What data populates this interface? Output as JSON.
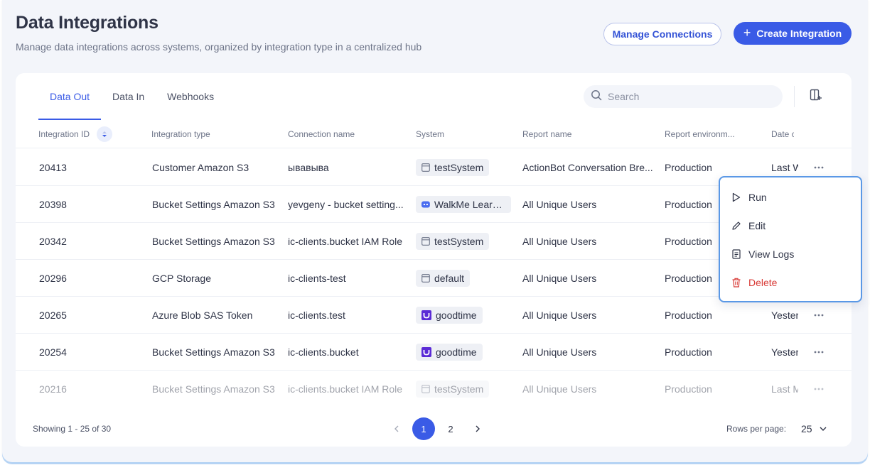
{
  "header": {
    "title": "Data Integrations",
    "subtitle": "Manage data integrations across systems, organized by integration type in a centralized hub",
    "manage_label": "Manage Connections",
    "create_label": "Create Integration"
  },
  "tabs": [
    {
      "label": "Data Out",
      "active": true
    },
    {
      "label": "Data In",
      "active": false
    },
    {
      "label": "Webhooks",
      "active": false
    }
  ],
  "search": {
    "placeholder": "Search"
  },
  "columns": {
    "id": "Integration ID",
    "type": "Integration type",
    "connection": "Connection name",
    "system": "System",
    "report": "Report name",
    "env": "Report environm...",
    "date": "Date c"
  },
  "rows": [
    {
      "id": "20413",
      "type": "Customer Amazon S3",
      "connection": "ывавыва",
      "system": "testSystem",
      "system_icon": "window-icon",
      "report": "ActionBot Conversation Bre...",
      "env": "Production",
      "date": "Last W"
    },
    {
      "id": "20398",
      "type": "Bucket Settings Amazon S3",
      "connection": "yevgeny - bucket setting...",
      "system": "WalkMe Learn...",
      "system_icon": "walkme-icon",
      "report": "All Unique Users",
      "env": "Production",
      "date": ""
    },
    {
      "id": "20342",
      "type": "Bucket Settings Amazon S3",
      "connection": "ic-clients.bucket IAM Role",
      "system": "testSystem",
      "system_icon": "window-icon",
      "report": "All Unique Users",
      "env": "Production",
      "date": ""
    },
    {
      "id": "20296",
      "type": "GCP Storage",
      "connection": "ic-clients-test",
      "system": "default",
      "system_icon": "window-icon",
      "report": "All Unique Users",
      "env": "Production",
      "date": ""
    },
    {
      "id": "20265",
      "type": "Azure Blob SAS Token",
      "connection": "ic-clients.test",
      "system": "goodtime",
      "system_icon": "goodtime-icon",
      "report": "All Unique Users",
      "env": "Production",
      "date": "Yester"
    },
    {
      "id": "20254",
      "type": "Bucket Settings Amazon S3",
      "connection": "ic-clients.bucket",
      "system": "goodtime",
      "system_icon": "goodtime-icon",
      "report": "All Unique Users",
      "env": "Production",
      "date": "Yester"
    },
    {
      "id": "20216",
      "type": "Bucket Settings Amazon S3",
      "connection": "ic-clients.bucket IAM Role",
      "system": "testSystem",
      "system_icon": "window-icon",
      "report": "All Unique Users",
      "env": "Production",
      "date": "Last M"
    }
  ],
  "footer": {
    "showing": "Showing 1 - 25 of 30",
    "pages": [
      "1",
      "2"
    ],
    "current_page": "1",
    "rows_label": "Rows per page:",
    "rows_value": "25"
  },
  "menu": {
    "items": [
      {
        "label": "Run",
        "icon": "play-icon"
      },
      {
        "label": "Edit",
        "icon": "pencil-icon"
      },
      {
        "label": "View Logs",
        "icon": "document-icon"
      },
      {
        "label": "Delete",
        "icon": "trash-icon"
      }
    ]
  },
  "colors": {
    "accent": "#3a5be6",
    "danger": "#d83a36",
    "menu_border": "#5a98e6",
    "goodtime": "#5b2bd6",
    "walkme": "#4a6cf0"
  }
}
